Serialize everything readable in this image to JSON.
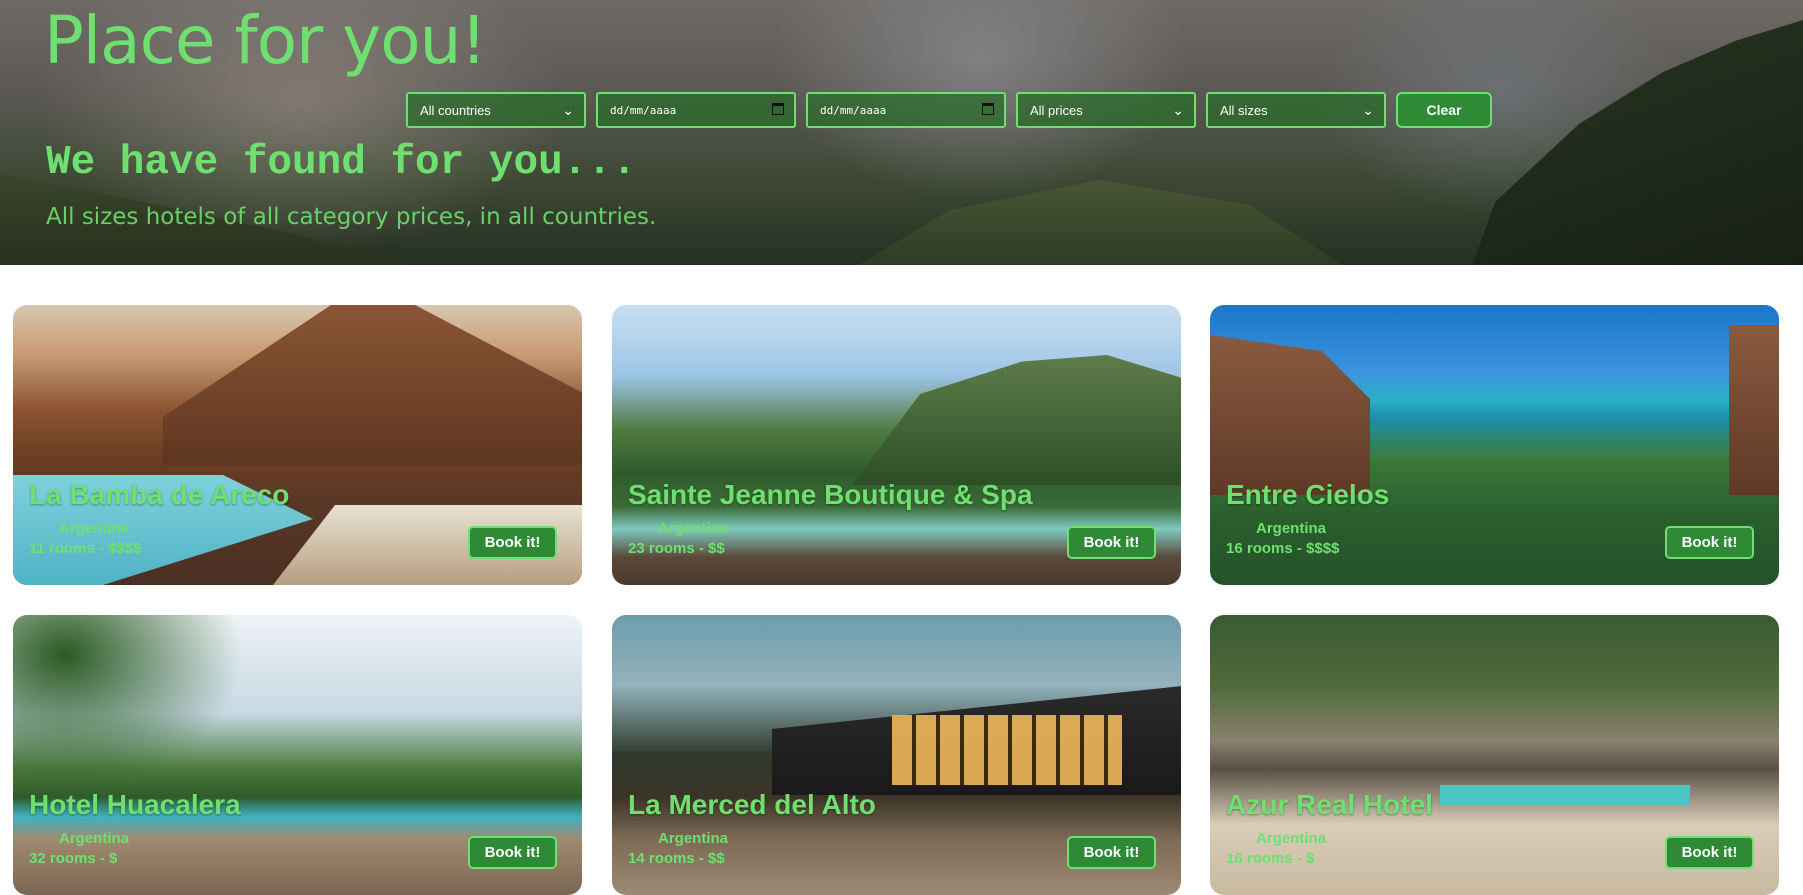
{
  "header": {
    "title": "Place for you!",
    "subtitle": "We have found for you...",
    "description": "All sizes hotels of all category prices, in all countries."
  },
  "filters": {
    "country": "All countries",
    "date_from": "dd/mm/aaaa",
    "date_to": "dd/mm/aaaa",
    "price": "All prices",
    "size": "All sizes",
    "clear_label": "Clear"
  },
  "hotels": [
    {
      "name": "La Bamba de Areco",
      "country": "Argentina",
      "rooms": "11 rooms - ",
      "price": "$$$$",
      "book_label": "Book it!"
    },
    {
      "name": "Sainte Jeanne Boutique & Spa",
      "country": "Argentina",
      "rooms": "23 rooms - ",
      "price": "$$",
      "book_label": "Book it!"
    },
    {
      "name": "Entre Cielos",
      "country": "Argentina",
      "rooms": "16 rooms - ",
      "price": "$$$$",
      "book_label": "Book it!"
    },
    {
      "name": "Hotel Huacalera",
      "country": "Argentina",
      "rooms": "32 rooms - ",
      "price": "$",
      "book_label": "Book it!"
    },
    {
      "name": "La Merced del Alto",
      "country": "Argentina",
      "rooms": "14 rooms - ",
      "price": "$$",
      "book_label": "Book it!"
    },
    {
      "name": "Azur Real Hotel",
      "country": "Argentina",
      "rooms": "16 rooms - ",
      "price": "$",
      "book_label": "Book it!"
    }
  ],
  "colors": {
    "accent": "#6fe06f",
    "button_bg": "#2e8a35",
    "button_text": "#ffffff"
  },
  "icons": {
    "select": "chevron-down-icon",
    "date": "calendar-icon"
  }
}
